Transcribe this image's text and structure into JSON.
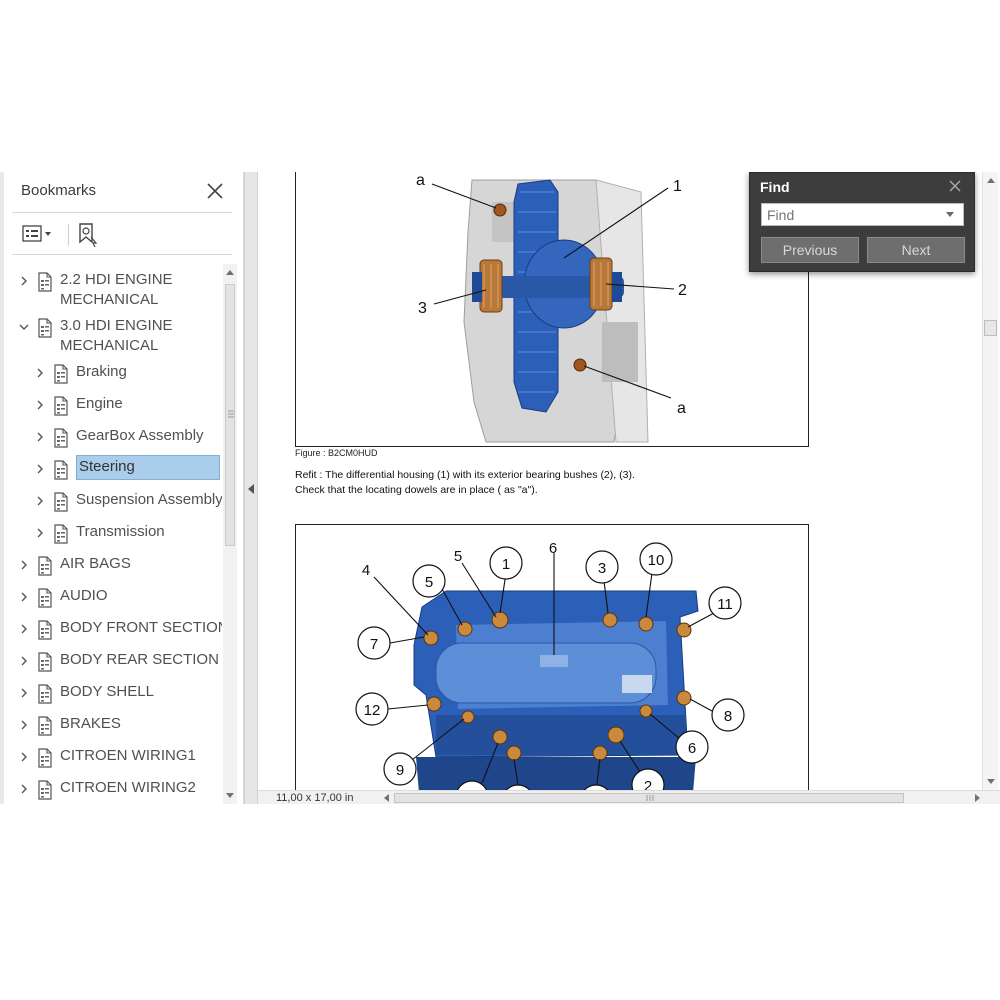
{
  "bookmarks": {
    "title": "Bookmarks",
    "items": [
      {
        "label": "2.2 HDI ENGINE\nMECHANICAL",
        "level": 0,
        "expanded": false
      },
      {
        "label": "3.0 HDI ENGINE\nMECHANICAL",
        "level": 0,
        "expanded": true
      },
      {
        "label": "Braking",
        "level": 1,
        "expanded": false
      },
      {
        "label": "Engine",
        "level": 1,
        "expanded": false
      },
      {
        "label": "GearBox Assembly",
        "level": 1,
        "expanded": false
      },
      {
        "label": "Steering",
        "level": 1,
        "expanded": false,
        "selected": true
      },
      {
        "label": "Suspension Assembly",
        "level": 1,
        "expanded": false
      },
      {
        "label": "Transmission",
        "level": 1,
        "expanded": false
      },
      {
        "label": "AIR BAGS",
        "level": 0,
        "expanded": false
      },
      {
        "label": "AUDIO",
        "level": 0,
        "expanded": false
      },
      {
        "label": "BODY FRONT SECTION",
        "level": 0,
        "expanded": false
      },
      {
        "label": "BODY REAR SECTION",
        "level": 0,
        "expanded": false
      },
      {
        "label": "BODY SHELL",
        "level": 0,
        "expanded": false
      },
      {
        "label": "BRAKES",
        "level": 0,
        "expanded": false
      },
      {
        "label": "CITROEN WIRING1",
        "level": 0,
        "expanded": false
      },
      {
        "label": "CITROEN WIRING2",
        "level": 0,
        "expanded": false
      }
    ]
  },
  "document": {
    "figure1_caption": "Figure : B2CM0HUD",
    "paragraph_line1": "Refit : The differential housing (1) with its exterior bearing bushes (2), (3).",
    "paragraph_line2": "Check that the locating dowels are in place ( as \"a\").",
    "figure1_callouts": [
      "a",
      "1",
      "2",
      "3",
      "a"
    ],
    "figure2_callouts": [
      "1",
      "2",
      "3",
      "4",
      "5",
      "5",
      "6",
      "6",
      "7",
      "8",
      "9",
      "10",
      "11",
      "12"
    ]
  },
  "status": {
    "page_size": "11,00 x 17,00 in"
  },
  "find": {
    "title": "Find",
    "placeholder": "Find",
    "previous_label": "Previous",
    "next_label": "Next"
  },
  "colors": {
    "part_blue": "#2c5fb8",
    "bolt_copper": "#b8783a",
    "selection": "#a9cdea",
    "find_bg": "#3d3d3d"
  }
}
